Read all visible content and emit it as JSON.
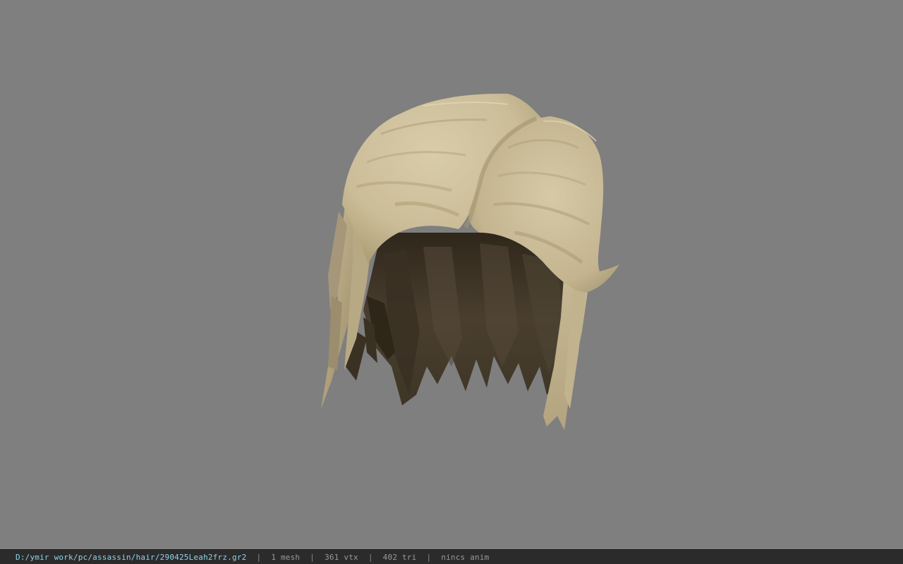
{
  "viewport": {
    "background_color": "#7f7f7f",
    "model": {
      "name": "hair-mesh",
      "colors": {
        "hair_light": "#d4c6a2",
        "hair_mid": "#b9aa86",
        "hair_shadow": "#8f8263",
        "hair_dark": "#4d4232",
        "hair_darker": "#3b3224"
      }
    }
  },
  "statusbar": {
    "file_path": "D:/ymir work/pc/assassin/hair/290425Leah2frz.gr2",
    "separator": "|",
    "mesh_count": "1 mesh",
    "vertex_count": "361 vtx",
    "triangle_count": "402 tri",
    "animation": "nincs anim",
    "path_color": "#8fd3e8"
  }
}
